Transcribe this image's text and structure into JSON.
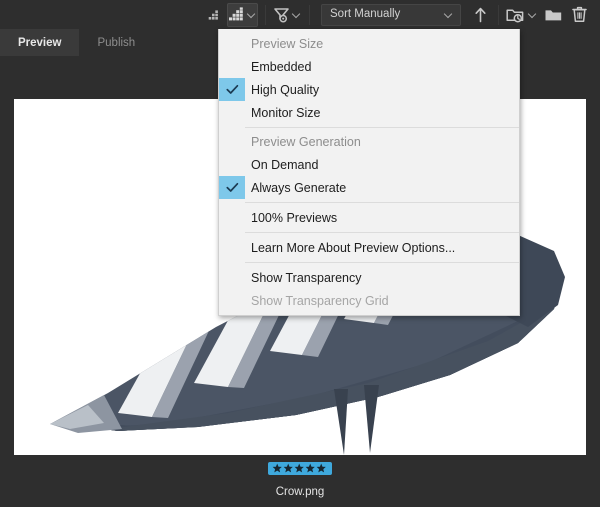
{
  "app": {
    "theme_bg": "#2e2e2e",
    "accent": "#3fa9dd"
  },
  "toolbar": {
    "items": [
      {
        "name": "thumbnail-size-small-icon",
        "label": "Smaller Thumbnail Size",
        "active": false
      },
      {
        "name": "thumbnail-size-large-icon",
        "label": "Larger Thumbnail Size",
        "active": true
      },
      {
        "name": "filter-icon",
        "label": "Filter Items By Rating",
        "active": false
      }
    ],
    "sort": {
      "value": "Sort Manually",
      "placeholder": "Sort Manually"
    },
    "ascending_label": "Sort Ascending",
    "recent_folders_label": "Recent Folders",
    "new_folder_label": "New Folder",
    "delete_label": "Delete"
  },
  "tabs": [
    {
      "label": "Preview",
      "selected": true
    },
    {
      "label": "Publish",
      "selected": false
    }
  ],
  "preview_menu": {
    "groups": [
      {
        "header": "Preview Size",
        "items": [
          {
            "label": "Embedded",
            "checked": false,
            "disabled": false
          },
          {
            "label": "High Quality",
            "checked": true,
            "disabled": false
          },
          {
            "label": "Monitor Size",
            "checked": false,
            "disabled": false
          }
        ]
      },
      {
        "header": "Preview Generation",
        "items": [
          {
            "label": "On Demand",
            "checked": false,
            "disabled": false
          },
          {
            "label": "Always Generate",
            "checked": true,
            "disabled": false
          }
        ]
      },
      {
        "header": null,
        "items": [
          {
            "label": "100% Previews",
            "checked": false,
            "disabled": false
          }
        ]
      },
      {
        "header": null,
        "items": [
          {
            "label": "Learn More About Preview Options...",
            "checked": false,
            "disabled": false
          }
        ]
      },
      {
        "header": null,
        "items": [
          {
            "label": "Show Transparency",
            "checked": false,
            "disabled": false
          },
          {
            "label": "Show Transparency Grid",
            "checked": false,
            "disabled": true
          }
        ]
      }
    ]
  },
  "file": {
    "name": "Crow.png",
    "rating": 5,
    "rating_max": 5,
    "rating_bg": "#3fa9dd"
  },
  "artwork": {
    "name": "crow-illustration",
    "alt": "Stylized dark angular crow with striped wing",
    "colors": {
      "body_dark": "#454f5e",
      "body_mid": "#6e7884",
      "stripe_light": "#eceef0",
      "stripe_mid": "#9aa2ae",
      "edge": "#2f3743"
    }
  }
}
